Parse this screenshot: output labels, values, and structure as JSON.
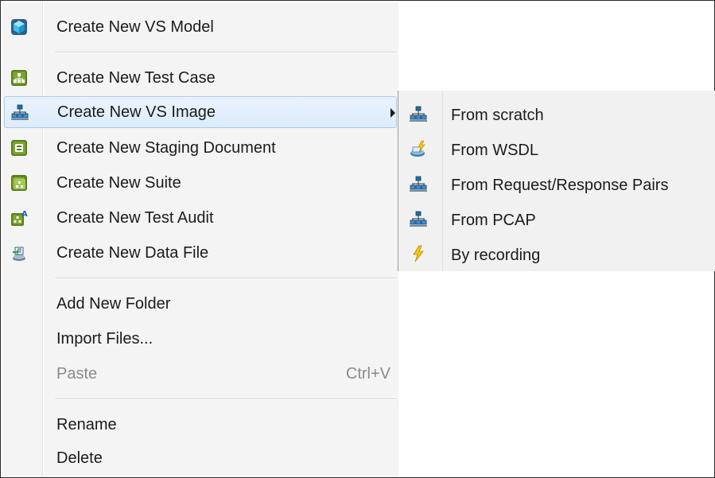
{
  "menu": {
    "items": [
      {
        "label": "Create New VS Model",
        "icon": "vs-model-icon"
      },
      {
        "label": "Create New Test Case",
        "icon": "test-case-icon"
      },
      {
        "label": "Create New VS Image",
        "icon": "vs-image-icon"
      },
      {
        "label": "Create New Staging Document",
        "icon": "staging-document-icon"
      },
      {
        "label": "Create New Suite",
        "icon": "suite-icon"
      },
      {
        "label": "Create New Test Audit",
        "icon": "test-audit-icon"
      },
      {
        "label": "Create New Data File",
        "icon": "data-file-icon"
      },
      {
        "label": "Add New Folder"
      },
      {
        "label": "Import Files..."
      },
      {
        "label": "Paste",
        "shortcut": "Ctrl+V",
        "disabled": true
      },
      {
        "label": "Rename"
      },
      {
        "label": "Delete"
      }
    ]
  },
  "submenu": {
    "items": [
      {
        "label": "From scratch",
        "icon": "network-icon"
      },
      {
        "label": "From WSDL",
        "icon": "wsdl-icon"
      },
      {
        "label": "From Request/Response Pairs",
        "icon": "network-icon"
      },
      {
        "label": "From PCAP",
        "icon": "network-icon"
      },
      {
        "label": "By recording",
        "icon": "lightning-icon"
      }
    ]
  },
  "colors": {
    "hover_fill": "#dcebfb",
    "hover_border": "#a9ccef",
    "menu_bg": "#f4f4f4",
    "icon_green": "#5b7f1e",
    "icon_blue": "#1f6fa8"
  }
}
